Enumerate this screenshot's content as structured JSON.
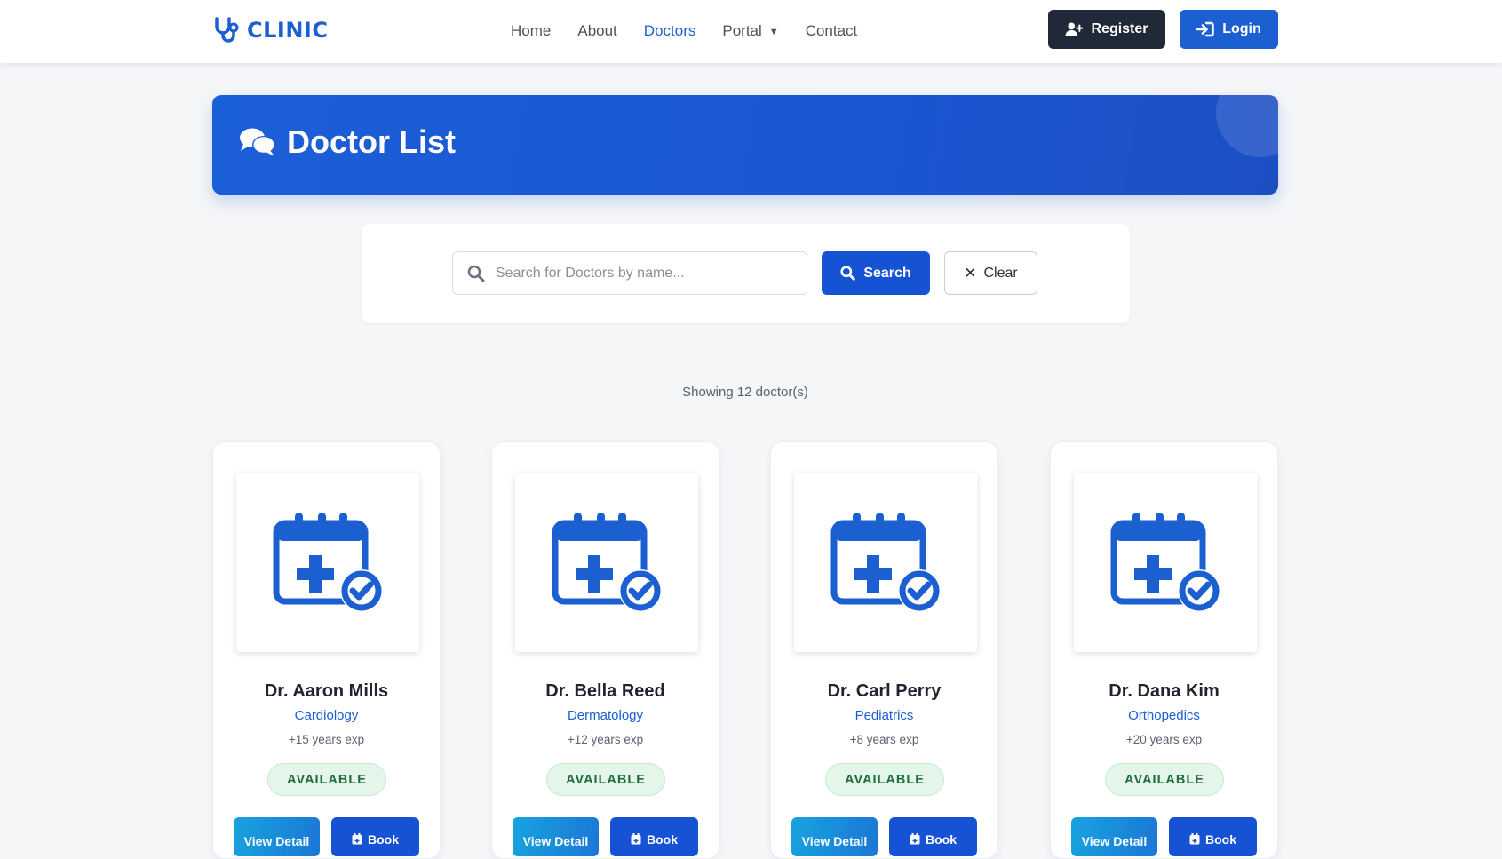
{
  "nav": {
    "brand": "CLINIC",
    "links": [
      {
        "label": "Home"
      },
      {
        "label": "About"
      },
      {
        "label": "Doctors"
      },
      {
        "label": "Portal"
      },
      {
        "label": "Contact"
      }
    ],
    "active": "Doctors",
    "register_label": "Register",
    "login_label": "Login"
  },
  "hero": {
    "title": "Doctor List",
    "icon": "comments-icon"
  },
  "search": {
    "placeholder": "Search for Doctors by name...",
    "value": "",
    "search_label": "Search",
    "clear_label": "Clear"
  },
  "results": {
    "text": "Showing 12 doctor(s)"
  },
  "doctors": [
    {
      "name": "Dr. Aaron Mills",
      "specialty": "Cardiology",
      "experience": "+15 years exp",
      "status": "AVAILABLE",
      "detail_label": "View Detail",
      "book_label": "Book"
    },
    {
      "name": "Dr. Bella Reed",
      "specialty": "Dermatology",
      "experience": "+12 years exp",
      "status": "AVAILABLE",
      "detail_label": "View Detail",
      "book_label": "Book"
    },
    {
      "name": "Dr. Carl Perry",
      "specialty": "Pediatrics",
      "experience": "+8 years exp",
      "status": "AVAILABLE",
      "detail_label": "View Detail",
      "book_label": "Book"
    },
    {
      "name": "Dr. Dana Kim",
      "specialty": "Orthopedics",
      "experience": "+20 years exp",
      "status": "AVAILABLE",
      "detail_label": "View Detail",
      "book_label": "Book"
    }
  ],
  "colors": {
    "primary": "#1b5fd1",
    "dark": "#1f2937",
    "available_bg": "#e3f6e9",
    "available_text": "#1f6b3b"
  }
}
